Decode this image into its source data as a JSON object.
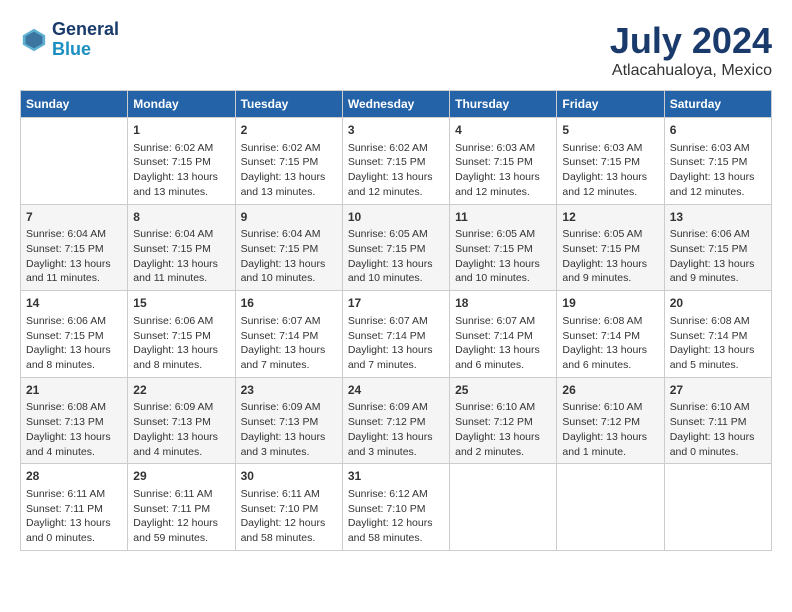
{
  "header": {
    "logo_line1": "General",
    "logo_line2": "Blue",
    "title": "July 2024",
    "subtitle": "Atlacahualoya, Mexico"
  },
  "columns": [
    "Sunday",
    "Monday",
    "Tuesday",
    "Wednesday",
    "Thursday",
    "Friday",
    "Saturday"
  ],
  "weeks": [
    [
      {
        "day": "",
        "info": ""
      },
      {
        "day": "1",
        "info": "Sunrise: 6:02 AM\nSunset: 7:15 PM\nDaylight: 13 hours\nand 13 minutes."
      },
      {
        "day": "2",
        "info": "Sunrise: 6:02 AM\nSunset: 7:15 PM\nDaylight: 13 hours\nand 13 minutes."
      },
      {
        "day": "3",
        "info": "Sunrise: 6:02 AM\nSunset: 7:15 PM\nDaylight: 13 hours\nand 12 minutes."
      },
      {
        "day": "4",
        "info": "Sunrise: 6:03 AM\nSunset: 7:15 PM\nDaylight: 13 hours\nand 12 minutes."
      },
      {
        "day": "5",
        "info": "Sunrise: 6:03 AM\nSunset: 7:15 PM\nDaylight: 13 hours\nand 12 minutes."
      },
      {
        "day": "6",
        "info": "Sunrise: 6:03 AM\nSunset: 7:15 PM\nDaylight: 13 hours\nand 12 minutes."
      }
    ],
    [
      {
        "day": "7",
        "info": "Sunrise: 6:04 AM\nSunset: 7:15 PM\nDaylight: 13 hours\nand 11 minutes."
      },
      {
        "day": "8",
        "info": "Sunrise: 6:04 AM\nSunset: 7:15 PM\nDaylight: 13 hours\nand 11 minutes."
      },
      {
        "day": "9",
        "info": "Sunrise: 6:04 AM\nSunset: 7:15 PM\nDaylight: 13 hours\nand 10 minutes."
      },
      {
        "day": "10",
        "info": "Sunrise: 6:05 AM\nSunset: 7:15 PM\nDaylight: 13 hours\nand 10 minutes."
      },
      {
        "day": "11",
        "info": "Sunrise: 6:05 AM\nSunset: 7:15 PM\nDaylight: 13 hours\nand 10 minutes."
      },
      {
        "day": "12",
        "info": "Sunrise: 6:05 AM\nSunset: 7:15 PM\nDaylight: 13 hours\nand 9 minutes."
      },
      {
        "day": "13",
        "info": "Sunrise: 6:06 AM\nSunset: 7:15 PM\nDaylight: 13 hours\nand 9 minutes."
      }
    ],
    [
      {
        "day": "14",
        "info": "Sunrise: 6:06 AM\nSunset: 7:15 PM\nDaylight: 13 hours\nand 8 minutes."
      },
      {
        "day": "15",
        "info": "Sunrise: 6:06 AM\nSunset: 7:15 PM\nDaylight: 13 hours\nand 8 minutes."
      },
      {
        "day": "16",
        "info": "Sunrise: 6:07 AM\nSunset: 7:14 PM\nDaylight: 13 hours\nand 7 minutes."
      },
      {
        "day": "17",
        "info": "Sunrise: 6:07 AM\nSunset: 7:14 PM\nDaylight: 13 hours\nand 7 minutes."
      },
      {
        "day": "18",
        "info": "Sunrise: 6:07 AM\nSunset: 7:14 PM\nDaylight: 13 hours\nand 6 minutes."
      },
      {
        "day": "19",
        "info": "Sunrise: 6:08 AM\nSunset: 7:14 PM\nDaylight: 13 hours\nand 6 minutes."
      },
      {
        "day": "20",
        "info": "Sunrise: 6:08 AM\nSunset: 7:14 PM\nDaylight: 13 hours\nand 5 minutes."
      }
    ],
    [
      {
        "day": "21",
        "info": "Sunrise: 6:08 AM\nSunset: 7:13 PM\nDaylight: 13 hours\nand 4 minutes."
      },
      {
        "day": "22",
        "info": "Sunrise: 6:09 AM\nSunset: 7:13 PM\nDaylight: 13 hours\nand 4 minutes."
      },
      {
        "day": "23",
        "info": "Sunrise: 6:09 AM\nSunset: 7:13 PM\nDaylight: 13 hours\nand 3 minutes."
      },
      {
        "day": "24",
        "info": "Sunrise: 6:09 AM\nSunset: 7:12 PM\nDaylight: 13 hours\nand 3 minutes."
      },
      {
        "day": "25",
        "info": "Sunrise: 6:10 AM\nSunset: 7:12 PM\nDaylight: 13 hours\nand 2 minutes."
      },
      {
        "day": "26",
        "info": "Sunrise: 6:10 AM\nSunset: 7:12 PM\nDaylight: 13 hours\nand 1 minute."
      },
      {
        "day": "27",
        "info": "Sunrise: 6:10 AM\nSunset: 7:11 PM\nDaylight: 13 hours\nand 0 minutes."
      }
    ],
    [
      {
        "day": "28",
        "info": "Sunrise: 6:11 AM\nSunset: 7:11 PM\nDaylight: 13 hours\nand 0 minutes."
      },
      {
        "day": "29",
        "info": "Sunrise: 6:11 AM\nSunset: 7:11 PM\nDaylight: 12 hours\nand 59 minutes."
      },
      {
        "day": "30",
        "info": "Sunrise: 6:11 AM\nSunset: 7:10 PM\nDaylight: 12 hours\nand 58 minutes."
      },
      {
        "day": "31",
        "info": "Sunrise: 6:12 AM\nSunset: 7:10 PM\nDaylight: 12 hours\nand 58 minutes."
      },
      {
        "day": "",
        "info": ""
      },
      {
        "day": "",
        "info": ""
      },
      {
        "day": "",
        "info": ""
      }
    ]
  ]
}
